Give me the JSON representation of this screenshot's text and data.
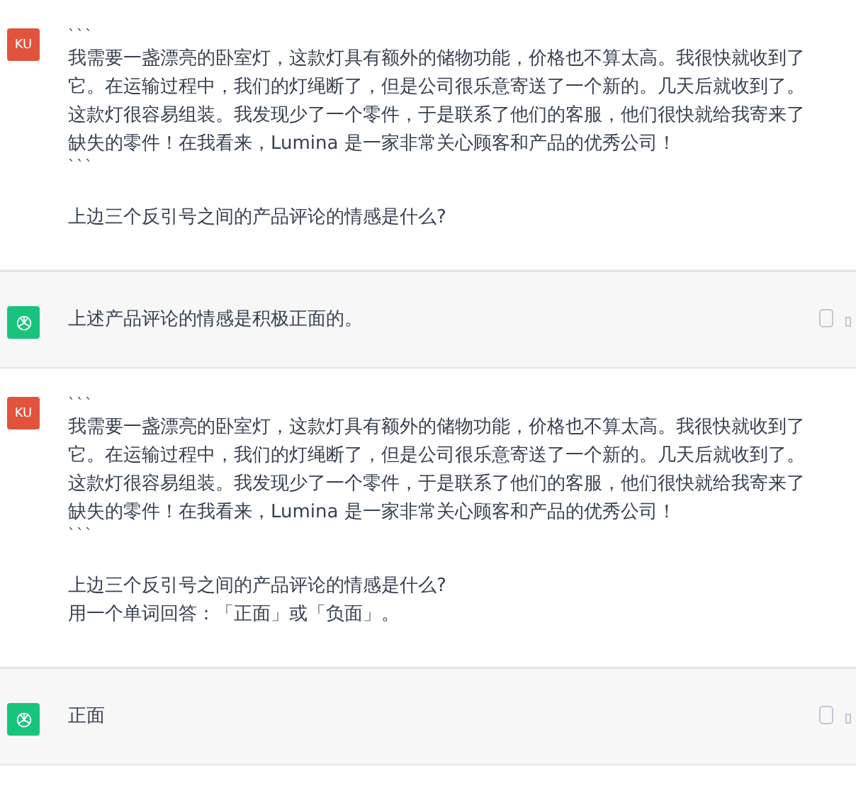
{
  "messages": [
    {
      "kind": "user",
      "avatar": "KU",
      "paragraphs": [
        [
          "```",
          "我需要一盏漂亮的卧室灯，这款灯具有额外的储物功能，价格也不算太高。我很快就收到了",
          "它。在运输过程中，我们的灯绳断了，但是公司很乐意寄送了一个新的。几天后就收到了。",
          "这款灯很容易组装。我发现少了一个零件，于是联系了他们的客服，他们很快就给我寄来了",
          "缺失的零件！在我看来，Lumina 是一家非常关心顾客和产品的优秀公司！",
          "```"
        ],
        [
          "上边三个反引号之间的产品评论的情感是什么?"
        ]
      ]
    },
    {
      "kind": "assistant",
      "paragraphs": [
        [
          "上述产品评论的情感是积极正面的。"
        ]
      ]
    },
    {
      "kind": "user",
      "avatar": "KU",
      "paragraphs": [
        [
          "```",
          "我需要一盏漂亮的卧室灯，这款灯具有额外的储物功能，价格也不算太高。我很快就收到了",
          "它。在运输过程中，我们的灯绳断了，但是公司很乐意寄送了一个新的。几天后就收到了。",
          "这款灯很容易组装。我发现少了一个零件，于是联系了他们的客服，他们很快就给我寄来了",
          "缺失的零件！在我看来，Lumina 是一家非常关心顾客和产品的优秀公司！",
          "```"
        ],
        [
          "上边三个反引号之间的产品评论的情感是什么?",
          "用一个单词回答：「正面」或「负面」。"
        ]
      ]
    },
    {
      "kind": "assistant",
      "paragraphs": [
        [
          "正面"
        ]
      ]
    }
  ]
}
